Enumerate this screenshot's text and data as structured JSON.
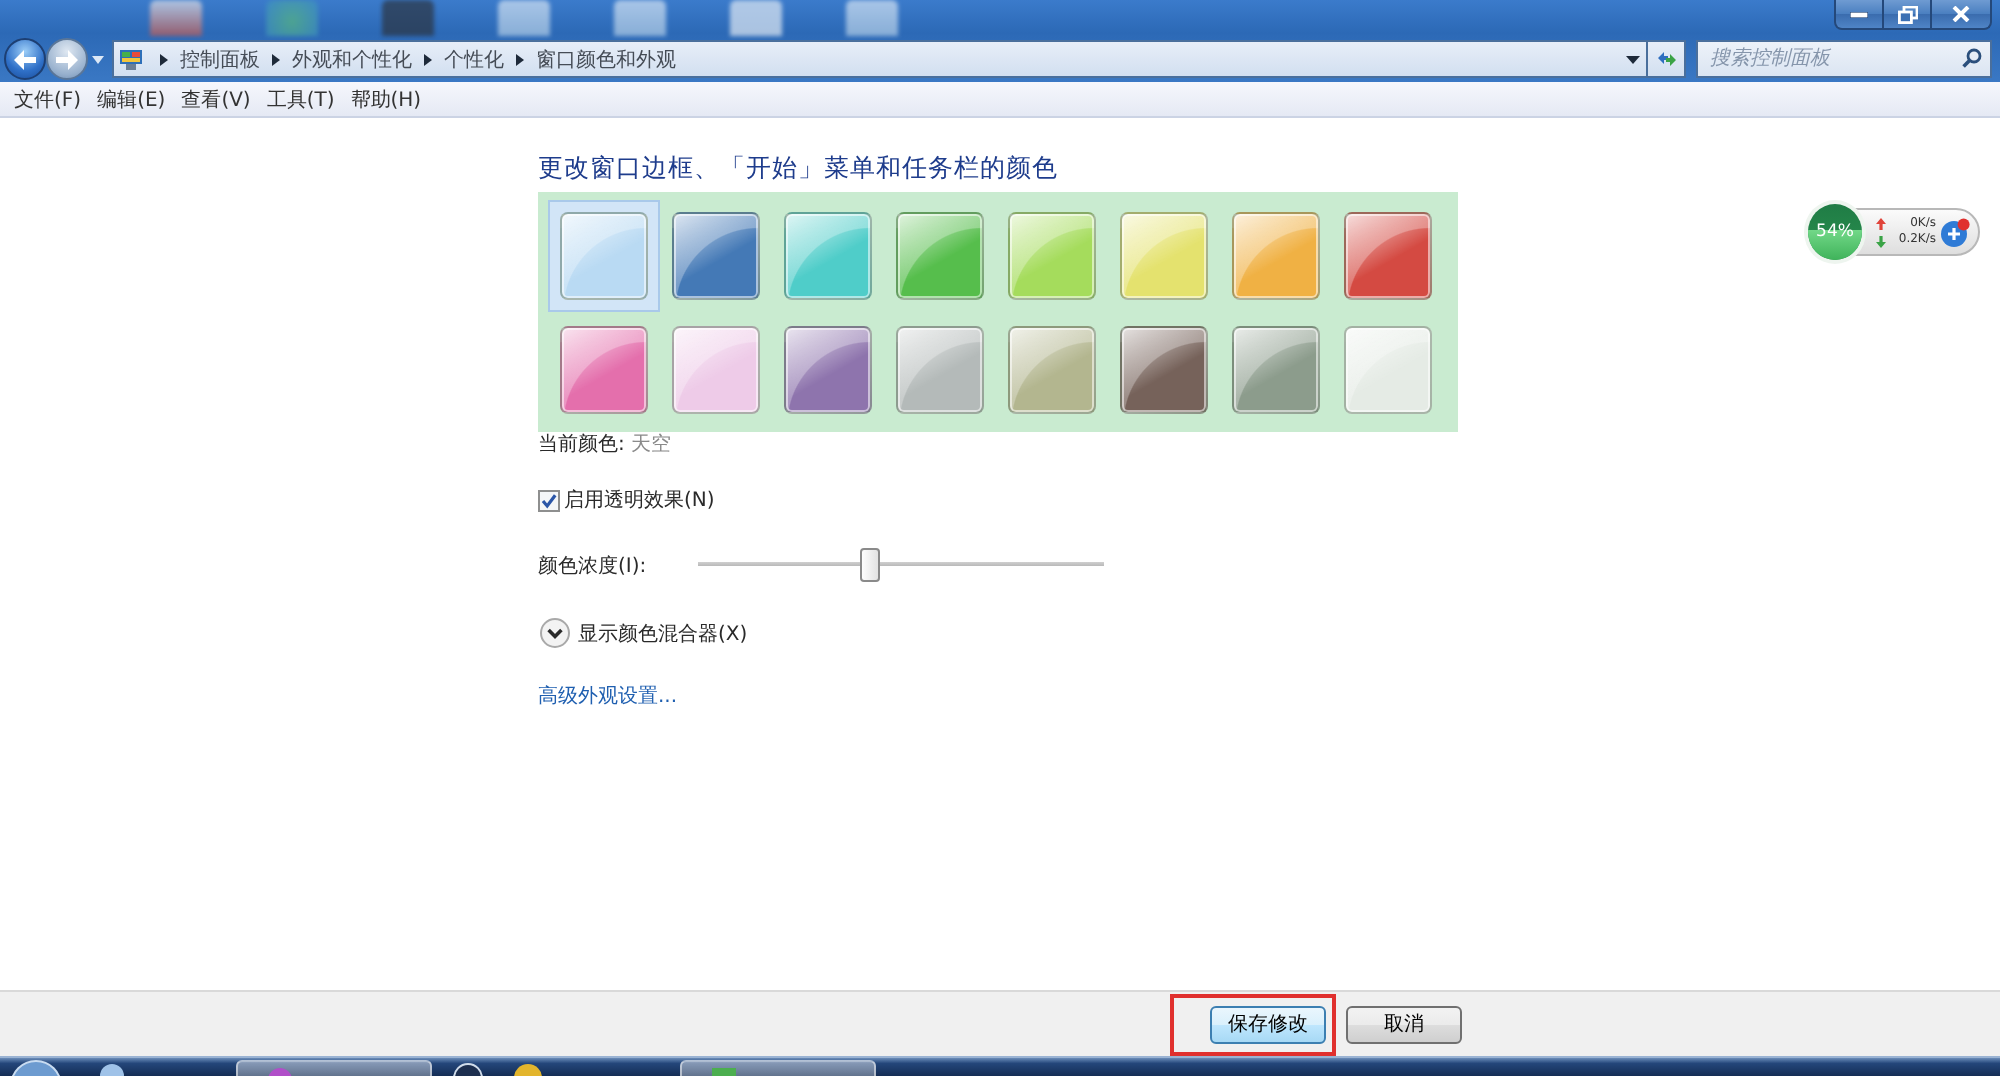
{
  "navigation": {
    "back": {
      "disabled": false
    },
    "forward": {
      "disabled": true
    },
    "breadcrumbs": [
      "控制面板",
      "外观和个性化",
      "个性化",
      "窗口颜色和外观"
    ],
    "search": {
      "placeholder": "搜索控制面板"
    }
  },
  "menu": [
    "文件(F)",
    "编辑(E)",
    "查看(V)",
    "工具(T)",
    "帮助(H)"
  ],
  "heading": "更改窗口边框、「开始」菜单和任务栏的颜色",
  "swatches": [
    {
      "color": "#b9daf3",
      "selected": true
    },
    {
      "color": "#4479b6",
      "selected": false
    },
    {
      "color": "#4fcdc9",
      "selected": false
    },
    {
      "color": "#56be4c",
      "selected": false
    },
    {
      "color": "#a5dc5c",
      "selected": false
    },
    {
      "color": "#e4e26e",
      "selected": false
    },
    {
      "color": "#f0b144",
      "selected": false
    },
    {
      "color": "#d44a42",
      "selected": false
    },
    {
      "color": "#e46fac",
      "selected": false
    },
    {
      "color": "#eecbe8",
      "selected": false
    },
    {
      "color": "#8e74ad",
      "selected": false
    },
    {
      "color": "#b4bab9",
      "selected": false
    },
    {
      "color": "#b3b68f",
      "selected": false
    },
    {
      "color": "#76625a",
      "selected": false
    },
    {
      "color": "#8c9c8c",
      "selected": false
    },
    {
      "color": "#e5ebe5",
      "selected": false
    }
  ],
  "current_color": {
    "label": "当前颜色:",
    "value": "天空"
  },
  "transparency": {
    "label": "启用透明效果(N)",
    "checked": true
  },
  "intensity": {
    "label": "颜色浓度(I):",
    "level": 0.42
  },
  "mixer": {
    "label": "显示颜色混合器(X)",
    "expanded": false
  },
  "advanced_link": "高级外观设置...",
  "gadget": {
    "percent": "54%",
    "level": 0.54,
    "upload": "0K/s",
    "download": "0.2K/s"
  },
  "buttons": [
    {
      "label": "保存修改",
      "default": true,
      "highlighted": true
    },
    {
      "label": "取消",
      "default": false,
      "highlighted": false
    }
  ]
}
